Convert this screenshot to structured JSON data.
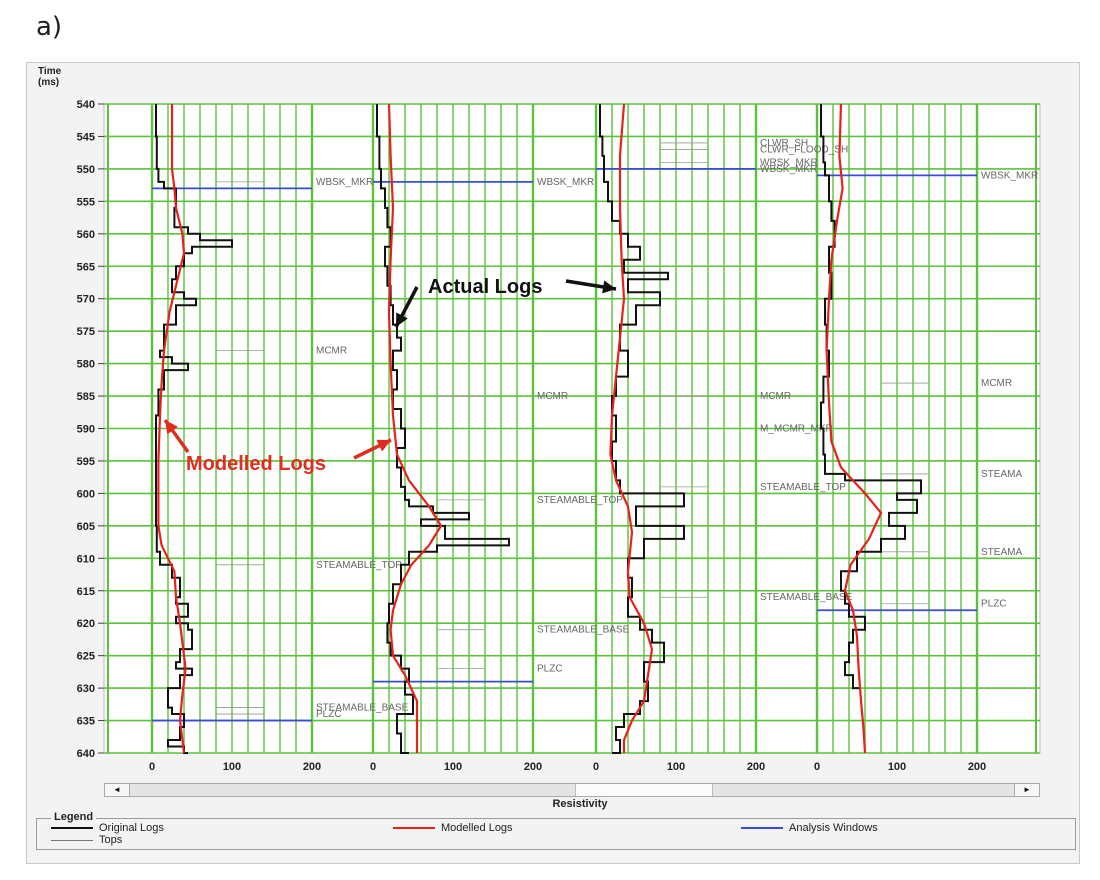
{
  "figure_label": "a)",
  "colors": {
    "grid": "#5cc13d",
    "original": "#111111",
    "modelled": "#e8211c",
    "analysis": "#3a4bd8",
    "tops": "#9a9a9a",
    "annotation_red": "#e02d1f"
  },
  "chart_data": {
    "type": "line",
    "title": "",
    "ylabel": "Time\n(ms)",
    "xlabel": "Resistivity",
    "ylim": [
      540,
      640
    ],
    "xlim": [
      0,
      200
    ],
    "y_ticks": [
      540,
      545,
      550,
      555,
      560,
      565,
      570,
      575,
      580,
      585,
      590,
      595,
      600,
      605,
      610,
      615,
      620,
      625,
      630,
      635,
      640
    ],
    "x_ticks": [
      0,
      100,
      200
    ],
    "grid": true,
    "series_legend": [
      {
        "name": "Original Logs",
        "color": "#111111"
      },
      {
        "name": "Modelled Logs",
        "color": "#e8211c"
      },
      {
        "name": "Analysis Windows",
        "color": "#3a4bd8"
      },
      {
        "name": "Tops",
        "color": "#9a9a9a"
      }
    ],
    "tracks": [
      {
        "original": [
          [
            5,
            540
          ],
          [
            6,
            545
          ],
          [
            8,
            550
          ],
          [
            15,
            552
          ],
          [
            30,
            553
          ],
          [
            28,
            556
          ],
          [
            45,
            559
          ],
          [
            60,
            560
          ],
          [
            100,
            561
          ],
          [
            50,
            562
          ],
          [
            40,
            563
          ],
          [
            30,
            565
          ],
          [
            25,
            567
          ],
          [
            40,
            569
          ],
          [
            55,
            570
          ],
          [
            30,
            571
          ],
          [
            15,
            574
          ],
          [
            10,
            578
          ],
          [
            25,
            579
          ],
          [
            45,
            580
          ],
          [
            15,
            581
          ],
          [
            8,
            584
          ],
          [
            5,
            588
          ],
          [
            5,
            595
          ],
          [
            5,
            600
          ],
          [
            6,
            605
          ],
          [
            10,
            609
          ],
          [
            25,
            611
          ],
          [
            35,
            613
          ],
          [
            30,
            616
          ],
          [
            45,
            617
          ],
          [
            30,
            619
          ],
          [
            45,
            620
          ],
          [
            50,
            621
          ],
          [
            35,
            624
          ],
          [
            30,
            626
          ],
          [
            50,
            627
          ],
          [
            35,
            628
          ],
          [
            20,
            630
          ],
          [
            25,
            633
          ],
          [
            40,
            634
          ],
          [
            35,
            636
          ],
          [
            20,
            638
          ],
          [
            40,
            639
          ],
          [
            45,
            640
          ]
        ],
        "modelled": [
          [
            25,
            540
          ],
          [
            25,
            550
          ],
          [
            28,
            553
          ],
          [
            30,
            556
          ],
          [
            38,
            560
          ],
          [
            40,
            563
          ],
          [
            32,
            567
          ],
          [
            22,
            572
          ],
          [
            15,
            578
          ],
          [
            12,
            583
          ],
          [
            10,
            588
          ],
          [
            8,
            595
          ],
          [
            8,
            600
          ],
          [
            8,
            605
          ],
          [
            12,
            608
          ],
          [
            28,
            612
          ],
          [
            30,
            616
          ],
          [
            35,
            620
          ],
          [
            38,
            623
          ],
          [
            42,
            627
          ],
          [
            38,
            631
          ],
          [
            35,
            635
          ],
          [
            40,
            640
          ]
        ],
        "windows": [
          553,
          635
        ],
        "tops": [
          {
            "name": "WBSK_MKR",
            "t": 552
          },
          {
            "name": "MCMR",
            "t": 578
          },
          {
            "name": "STEAMABLE_TOP",
            "t": 611
          },
          {
            "name": "STEAMABLE_BASE",
            "t": 633
          },
          {
            "name": "PLZC",
            "t": 634
          }
        ]
      },
      {
        "original": [
          [
            5,
            540
          ],
          [
            8,
            545
          ],
          [
            10,
            550
          ],
          [
            15,
            553
          ],
          [
            18,
            556
          ],
          [
            22,
            559
          ],
          [
            15,
            562
          ],
          [
            18,
            565
          ],
          [
            22,
            568
          ],
          [
            25,
            571
          ],
          [
            30,
            574
          ],
          [
            35,
            576
          ],
          [
            25,
            578
          ],
          [
            30,
            581
          ],
          [
            25,
            584
          ],
          [
            35,
            587
          ],
          [
            40,
            590
          ],
          [
            30,
            593
          ],
          [
            35,
            596
          ],
          [
            40,
            599
          ],
          [
            45,
            601
          ],
          [
            75,
            602
          ],
          [
            120,
            603
          ],
          [
            60,
            604
          ],
          [
            90,
            605
          ],
          [
            170,
            607
          ],
          [
            80,
            608
          ],
          [
            45,
            609
          ],
          [
            35,
            611
          ],
          [
            25,
            614
          ],
          [
            20,
            617
          ],
          [
            18,
            620
          ],
          [
            22,
            623
          ],
          [
            35,
            625
          ],
          [
            45,
            627
          ],
          [
            40,
            629
          ],
          [
            50,
            631
          ],
          [
            30,
            634
          ],
          [
            35,
            637
          ],
          [
            45,
            640
          ]
        ],
        "modelled": [
          [
            20,
            540
          ],
          [
            22,
            548
          ],
          [
            25,
            556
          ],
          [
            22,
            564
          ],
          [
            20,
            572
          ],
          [
            22,
            580
          ],
          [
            25,
            588
          ],
          [
            30,
            594
          ],
          [
            45,
            598
          ],
          [
            70,
            602
          ],
          [
            85,
            605
          ],
          [
            70,
            608
          ],
          [
            48,
            611
          ],
          [
            35,
            614
          ],
          [
            25,
            618
          ],
          [
            22,
            621
          ],
          [
            25,
            625
          ],
          [
            40,
            628
          ],
          [
            55,
            632
          ],
          [
            55,
            636
          ],
          [
            55,
            640
          ]
        ],
        "windows": [
          552,
          629
        ],
        "tops": [
          {
            "name": "WBSK_MKR",
            "t": 552
          },
          {
            "name": "MCMR",
            "t": 585
          },
          {
            "name": "STEAMABLE_TOP",
            "t": 601
          },
          {
            "name": "STEAMABLE_BASE",
            "t": 621
          },
          {
            "name": "PLZC",
            "t": 627
          }
        ]
      },
      {
        "original": [
          [
            5,
            540
          ],
          [
            8,
            545
          ],
          [
            10,
            548
          ],
          [
            15,
            552
          ],
          [
            20,
            555
          ],
          [
            30,
            558
          ],
          [
            40,
            560
          ],
          [
            55,
            562
          ],
          [
            35,
            564
          ],
          [
            90,
            566
          ],
          [
            40,
            567
          ],
          [
            80,
            569
          ],
          [
            50,
            571
          ],
          [
            30,
            574
          ],
          [
            40,
            578
          ],
          [
            25,
            582
          ],
          [
            20,
            585
          ],
          [
            25,
            588
          ],
          [
            20,
            592
          ],
          [
            25,
            595
          ],
          [
            30,
            598
          ],
          [
            110,
            600
          ],
          [
            50,
            602
          ],
          [
            110,
            605
          ],
          [
            60,
            607
          ],
          [
            40,
            610
          ],
          [
            45,
            613
          ],
          [
            40,
            616
          ],
          [
            55,
            619
          ],
          [
            70,
            621
          ],
          [
            85,
            623
          ],
          [
            60,
            626
          ],
          [
            65,
            629
          ],
          [
            55,
            632
          ],
          [
            35,
            634
          ],
          [
            25,
            636
          ],
          [
            30,
            638
          ],
          [
            20,
            640
          ]
        ],
        "modelled": [
          [
            35,
            540
          ],
          [
            30,
            548
          ],
          [
            30,
            556
          ],
          [
            32,
            564
          ],
          [
            35,
            570
          ],
          [
            30,
            576
          ],
          [
            25,
            582
          ],
          [
            20,
            588
          ],
          [
            18,
            594
          ],
          [
            25,
            598
          ],
          [
            40,
            602
          ],
          [
            45,
            606
          ],
          [
            40,
            612
          ],
          [
            42,
            616
          ],
          [
            60,
            620
          ],
          [
            70,
            624
          ],
          [
            65,
            628
          ],
          [
            60,
            632
          ],
          [
            45,
            635
          ],
          [
            35,
            638
          ],
          [
            35,
            640
          ]
        ],
        "windows": [
          550
        ],
        "tops": [
          {
            "name": "CLWR_SH",
            "t": 546
          },
          {
            "name": "CLWR_FLOOD_SH",
            "t": 547
          },
          {
            "name": "WRSK_MKR",
            "t": 549
          },
          {
            "name": "WBSK_MKR",
            "t": 550
          },
          {
            "name": "MCMR",
            "t": 585
          },
          {
            "name": "M_MCMR_MKR",
            "t": 590
          },
          {
            "name": "STEAMABLE_TOP",
            "t": 599
          },
          {
            "name": "STEAMABLE_BASE",
            "t": 616
          }
        ]
      },
      {
        "original": [
          [
            5,
            540
          ],
          [
            8,
            545
          ],
          [
            10,
            549
          ],
          [
            15,
            551
          ],
          [
            18,
            555
          ],
          [
            22,
            558
          ],
          [
            15,
            562
          ],
          [
            18,
            566
          ],
          [
            10,
            570
          ],
          [
            12,
            574
          ],
          [
            15,
            578
          ],
          [
            8,
            582
          ],
          [
            5,
            586
          ],
          [
            8,
            590
          ],
          [
            10,
            594
          ],
          [
            35,
            597
          ],
          [
            130,
            598
          ],
          [
            100,
            600
          ],
          [
            125,
            601
          ],
          [
            90,
            603
          ],
          [
            110,
            605
          ],
          [
            80,
            607
          ],
          [
            50,
            609
          ],
          [
            30,
            612
          ],
          [
            35,
            615
          ],
          [
            40,
            617
          ],
          [
            60,
            619
          ],
          [
            45,
            621
          ],
          [
            40,
            623
          ],
          [
            35,
            626
          ],
          [
            45,
            628
          ],
          [
            55,
            630
          ]
        ],
        "modelled": [
          [
            30,
            540
          ],
          [
            28,
            548
          ],
          [
            32,
            553
          ],
          [
            25,
            558
          ],
          [
            18,
            564
          ],
          [
            15,
            570
          ],
          [
            12,
            578
          ],
          [
            15,
            586
          ],
          [
            18,
            592
          ],
          [
            30,
            596
          ],
          [
            60,
            600
          ],
          [
            80,
            603
          ],
          [
            65,
            607
          ],
          [
            42,
            611
          ],
          [
            35,
            615
          ],
          [
            45,
            618
          ],
          [
            50,
            622
          ],
          [
            52,
            627
          ],
          [
            55,
            632
          ],
          [
            58,
            636
          ],
          [
            60,
            640
          ]
        ],
        "windows": [
          551,
          618
        ],
        "tops": [
          {
            "name": "WBSK_MKR",
            "t": 551
          },
          {
            "name": "MCMR",
            "t": 583
          },
          {
            "name": "STEAMA",
            "t": 597
          },
          {
            "name": "STEAMA",
            "t": 609
          },
          {
            "name": "PLZC",
            "t": 617
          }
        ]
      }
    ],
    "annotations": [
      {
        "text": "Actual Logs",
        "color": "#111111"
      },
      {
        "text": "Modelled Logs",
        "color": "#e02d1f"
      }
    ]
  },
  "scroll": {
    "left_arrow": "◄",
    "right_arrow": "►"
  },
  "legend": {
    "title": "Legend",
    "original": "Original Logs",
    "modelled": "Modelled Logs",
    "analysis": "Analysis Windows",
    "tops": "Tops"
  }
}
